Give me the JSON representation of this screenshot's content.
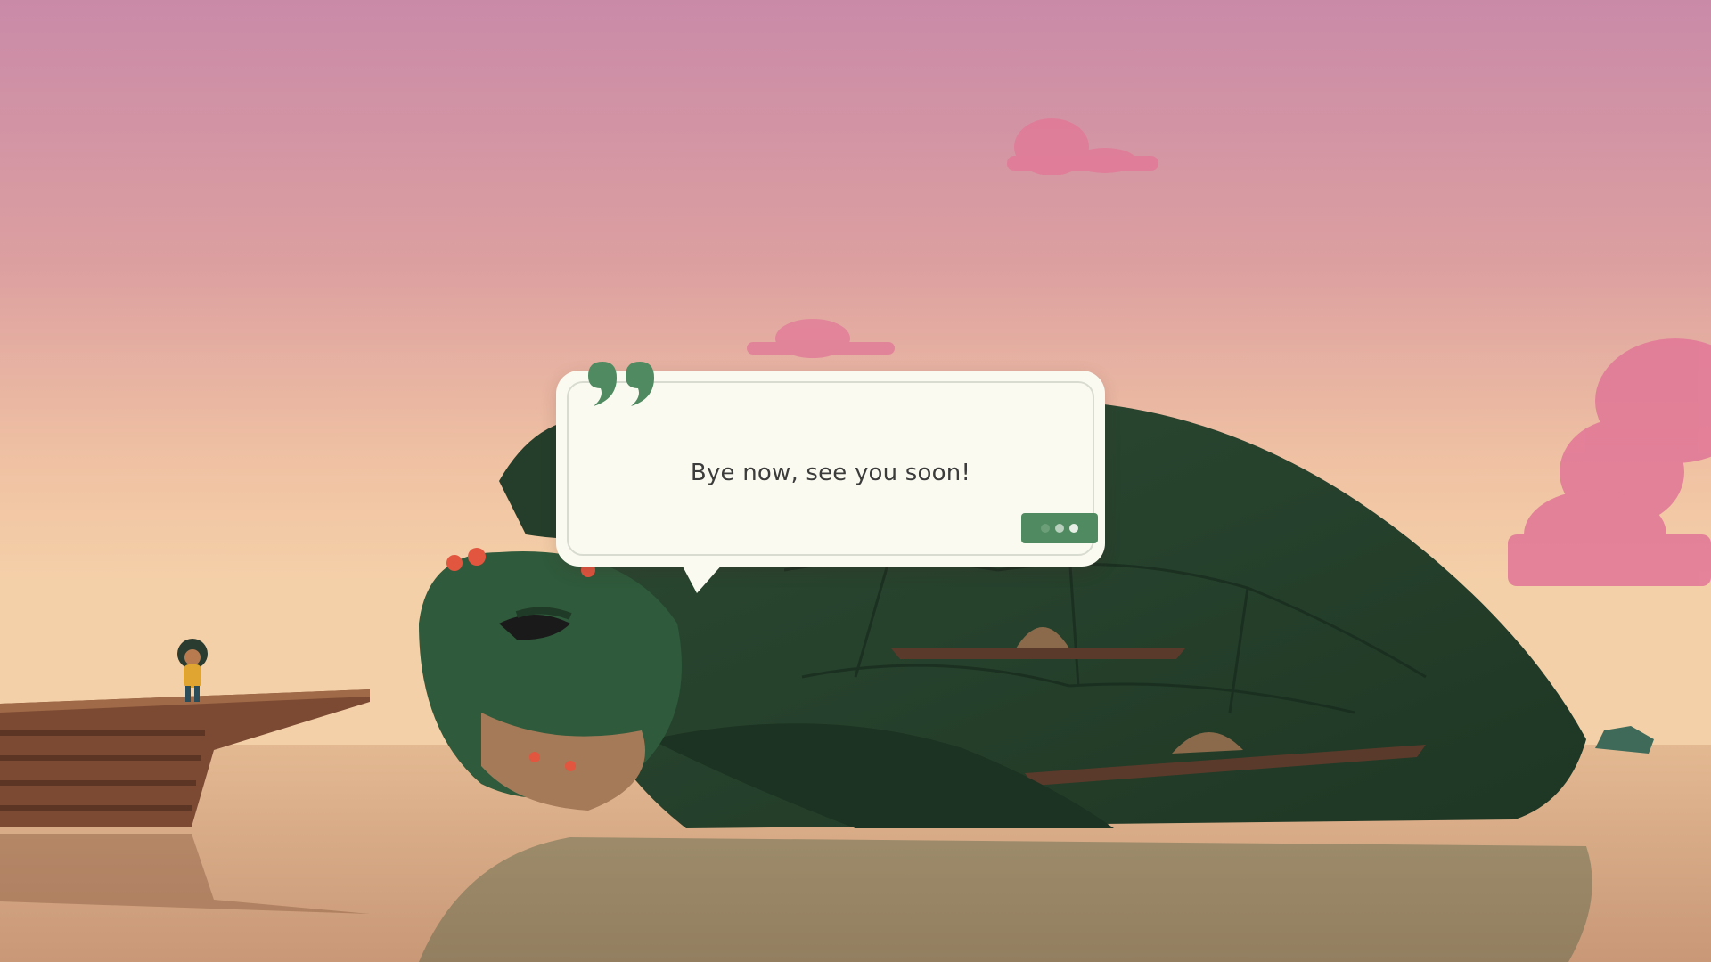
{
  "dialog": {
    "text": "Bye now, see you soon!",
    "continue_icon": "ellipsis-dots-icon",
    "quote_icon": "quote-mark-icon"
  },
  "colors": {
    "sky_top": "#c98aa8",
    "sky_bottom": "#f2c9a0",
    "water": "#d8ad8a",
    "turtle": "#2f4f36",
    "turtle_dark": "#1f3a26",
    "dialog_bg": "#fbfaf1",
    "accent_green": "#4f8a60",
    "cloud": "#e27a98"
  }
}
